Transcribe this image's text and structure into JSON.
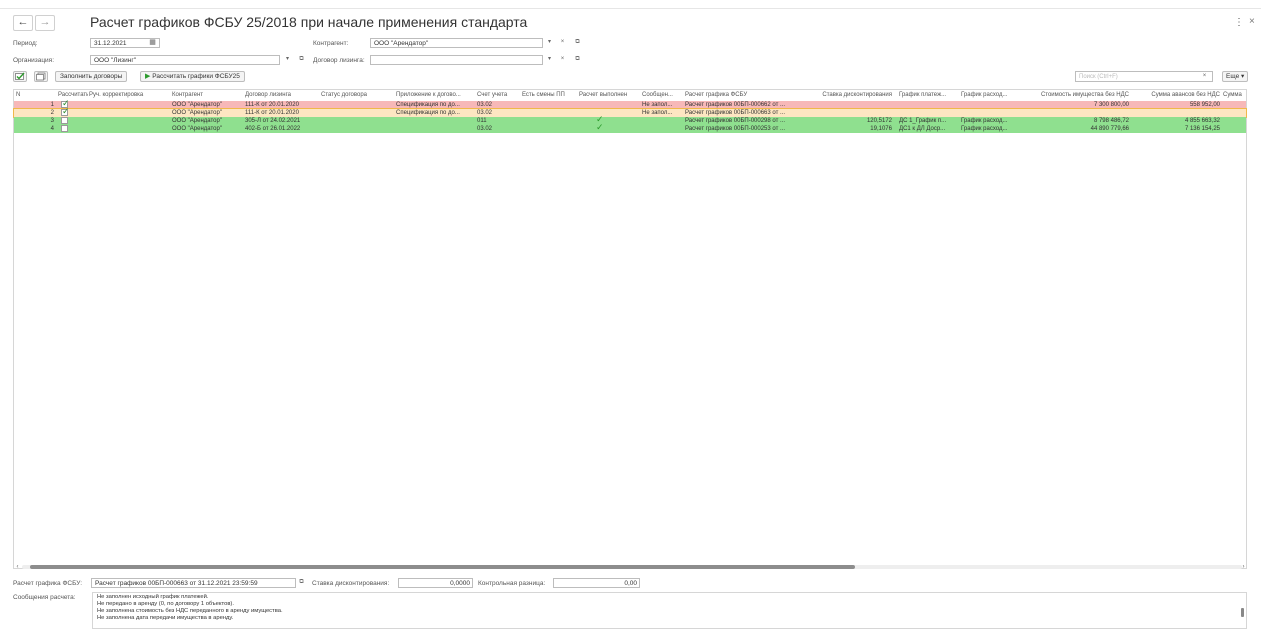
{
  "window": {
    "title": "Расчет графиков ФСБУ 25/2018 при начале применения стандарта",
    "back": "←",
    "forward": "→",
    "more": "⋮",
    "close": "×"
  },
  "form": {
    "period_label": "Период:",
    "period_value": "31.12.2021",
    "org_label": "Организация:",
    "org_value": "ООО \"Лизинг\"",
    "contractor_label": "Контрагент:",
    "contractor_value": "ООО \"Арендатор\"",
    "contract_label": "Договор лизинга:",
    "contract_value": ""
  },
  "toolbar": {
    "fill_label": "Заполнить договоры",
    "calc_label": "Рассчитать графики ФСБУ25",
    "search_placeholder": "Поиск (Ctrl+F)",
    "more_label": "Еще ▾"
  },
  "table": {
    "columns": [
      "N",
      "Рассчитать",
      "Руч. корректировка",
      "Контрагент",
      "Договор лизинга",
      "Статус договора",
      "Приложение к догово...",
      "Счет учета",
      "Есть смены ПП",
      "Расчет выполнен",
      "Сообщен...",
      "Расчет графика ФСБУ",
      "Ставка дисконтирования",
      "График платеж...",
      "График расход...",
      "Стоимость имущества без НДС",
      "Сумма авансов без НДС",
      "Сумма"
    ],
    "rows": [
      {
        "n": "1",
        "calc": true,
        "contractor": "ООО \"Арендатор\"",
        "contract": "111-К от 20.01.2020",
        "appendix": "Спецификация по до...",
        "account": "03.02",
        "done": false,
        "message": "Не запол...",
        "schedule": "Расчет графиков 00БП-000662 от ...",
        "rate": "",
        "pay": "",
        "exp": "",
        "cost": "7 300 800,00",
        "adv": "558 952,00",
        "state": "error"
      },
      {
        "n": "2",
        "calc": true,
        "contractor": "ООО \"Арендатор\"",
        "contract": "111-К от 20.01.2020",
        "appendix": "Спецификация по до...",
        "account": "03.02",
        "done": false,
        "message": "Не запол...",
        "schedule": "Расчет графиков 00БП-000663 от ...",
        "rate": "",
        "pay": "",
        "exp": "",
        "cost": "",
        "adv": "",
        "state": "selected"
      },
      {
        "n": "3",
        "calc": false,
        "contractor": "ООО \"Арендатор\"",
        "contract": "305-Л от 24.02.2021",
        "appendix": "",
        "account": "011",
        "done": true,
        "message": "",
        "schedule": "Расчет графиков 00БП-000298 от ...",
        "rate": "120,5172",
        "pay": "ДС 1_График п...",
        "exp": "График расход...",
        "cost": "8 798 486,72",
        "adv": "4 855 663,32",
        "state": "ok"
      },
      {
        "n": "4",
        "calc": false,
        "contractor": "ООО \"Арендатор\"",
        "contract": "402-Б от 26.01.2022",
        "appendix": "",
        "account": "03.02",
        "done": true,
        "message": "",
        "schedule": "Расчет графиков 00БП-000253 от ...",
        "rate": "19,1076",
        "pay": "ДС1 к ДЛ Доср...",
        "exp": "График расход...",
        "cost": "44 890 779,66",
        "adv": "7 136 154,25",
        "state": "ok"
      }
    ]
  },
  "footer": {
    "schedule_label": "Расчет графика ФСБУ:",
    "schedule_value": "Расчет графиков 00БП-000663 от 31.12.2021 23:59:59",
    "rate_label": "Ставка дисконтирования:",
    "rate_value": "0,0000",
    "diff_label": "Контрольная разница:",
    "diff_value": "0,00",
    "messages_label": "Сообщения расчета:",
    "messages": [
      "Не заполнен исходный график платежей.",
      "Не передано в аренду (0, по договору 1 объектов).",
      "Не заполнена стоимость без НДС переданного в аренду имущества.",
      "Не заполнена дата передачи имущества в аренду."
    ]
  },
  "colors": {
    "error_row": "#f7b8b8",
    "selected_row": "#fde6c2",
    "ok_row": "#8fe08f",
    "accent": "#2c9a2c"
  }
}
